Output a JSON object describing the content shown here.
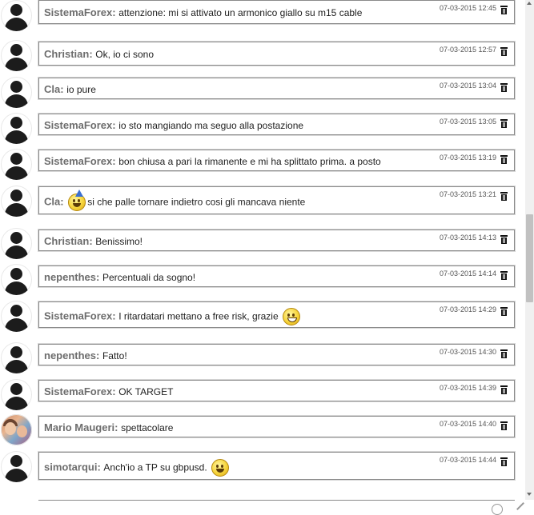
{
  "messages": [
    {
      "author": "SistemaForex:",
      "text": "attenzione: mi si attivato un armonico giallo su m15 cable",
      "time": "07-03-2015 12:45",
      "avatar": "default"
    },
    {
      "author": "Christian:",
      "text": "Ok, io ci sono",
      "time": "07-03-2015 12:57",
      "avatar": "default"
    },
    {
      "author": "Cla:",
      "text": "io pure",
      "time": "07-03-2015 13:04",
      "avatar": "default"
    },
    {
      "author": "SistemaForex:",
      "text": "io sto mangiando ma seguo alla postazione",
      "time": "07-03-2015 13:05",
      "avatar": "default"
    },
    {
      "author": "SistemaForex:",
      "text": "bon chiusa a pari la rimanente e mi ha splittato prima. a posto",
      "time": "07-03-2015 13:19",
      "avatar": "default"
    },
    {
      "author": "Cla:",
      "text": "si che palle tornare indietro cosi gli mancava niente",
      "time": "07-03-2015 13:21",
      "avatar": "default",
      "emoji_before": "party-emoji"
    },
    {
      "author": "Christian:",
      "text": "Benissimo!",
      "time": "07-03-2015 14:13",
      "avatar": "default"
    },
    {
      "author": "nepenthes:",
      "text": "Percentuali da sogno!",
      "time": "07-03-2015 14:14",
      "avatar": "default"
    },
    {
      "author": "SistemaForex:",
      "text": "I ritardatari mettano a free risk, grazie",
      "time": "07-03-2015 14:29",
      "avatar": "default",
      "emoji_after": "grin-emoji"
    },
    {
      "author": "nepenthes:",
      "text": "Fatto!",
      "time": "07-03-2015 14:30",
      "avatar": "default"
    },
    {
      "author": "SistemaForex:",
      "text": "OK TARGET",
      "time": "07-03-2015 14:39",
      "avatar": "default"
    },
    {
      "author": "Mario Maugeri:",
      "text": "spettacolare",
      "time": "07-03-2015 14:40",
      "avatar": "photo"
    },
    {
      "author": "simotarqui:",
      "text": "Anch'io a TP su gbpusd.",
      "time": "07-03-2015 14:44",
      "avatar": "default",
      "emoji_after": "smile-emoji"
    }
  ],
  "icons": {
    "delete": "trash-icon",
    "composer_emoji": "smiley-icon",
    "composer_edit": "pencil-icon"
  },
  "colors": {
    "author": "#6d6d6d",
    "border": "#8a8a8a",
    "text": "#1e1e1e"
  }
}
